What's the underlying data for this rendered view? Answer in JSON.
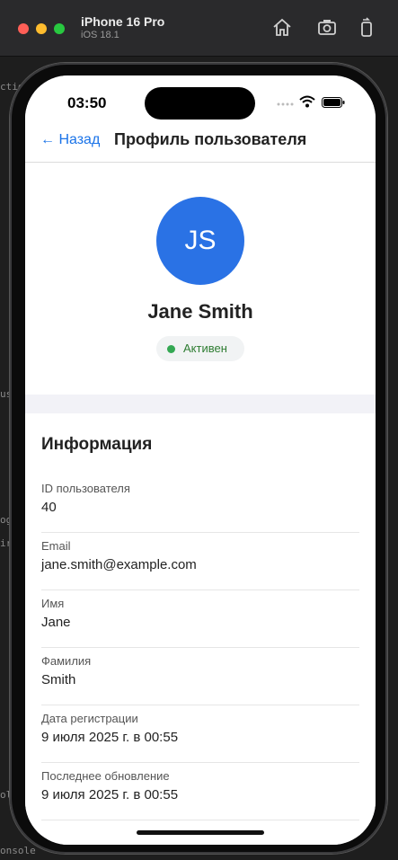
{
  "simulator": {
    "device_name": "iPhone 16 Pro",
    "os_version": "iOS 18.1",
    "icons": [
      "home-icon",
      "screenshot-icon",
      "rotate-icon"
    ]
  },
  "background_ide": {
    "fragments": [
      "ctions",
      "ogis",
      "irr",
      "us",
      "olo",
      "onsole"
    ]
  },
  "status_bar": {
    "time": "03:50"
  },
  "nav": {
    "back_label": "← Назад",
    "title": "Профиль пользователя"
  },
  "profile": {
    "initials": "JS",
    "name": "Jane Smith",
    "status": "Активен",
    "avatar_color": "#2a72e5",
    "status_color": "#34a853"
  },
  "info": {
    "title": "Информация",
    "rows": [
      {
        "label": "ID пользователя",
        "value": "40"
      },
      {
        "label": "Email",
        "value": "jane.smith@example.com"
      },
      {
        "label": "Имя",
        "value": "Jane"
      },
      {
        "label": "Фамилия",
        "value": "Smith"
      },
      {
        "label": "Дата регистрации",
        "value": "9 июля 2025 г. в 00:55"
      },
      {
        "label": "Последнее обновление",
        "value": "9 июля 2025 г. в 00:55"
      }
    ]
  },
  "colors": {
    "accent": "#1a73e8"
  }
}
